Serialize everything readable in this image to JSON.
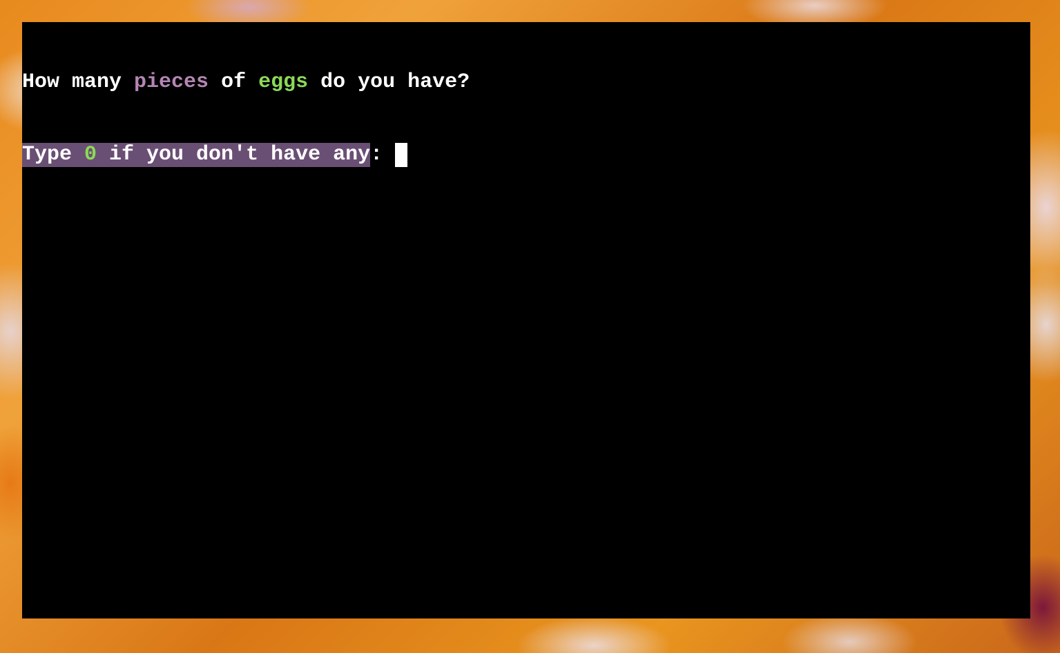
{
  "terminal": {
    "line1": {
      "part1": "How many ",
      "unit": "pieces",
      "part2": " of ",
      "ingredient": "eggs",
      "part3": " do you have?"
    },
    "line2": {
      "part1": "Type ",
      "zero": "0",
      "part2": " if you don't have any",
      "colon": ": "
    },
    "input_value": ""
  },
  "colors": {
    "terminal_bg": "#000000",
    "text": "#ffffff",
    "unit_highlight": "#b486b4",
    "ingredient_highlight": "#8cd957",
    "selection_bg": "#6a4f74",
    "cursor": "#ffffff"
  }
}
